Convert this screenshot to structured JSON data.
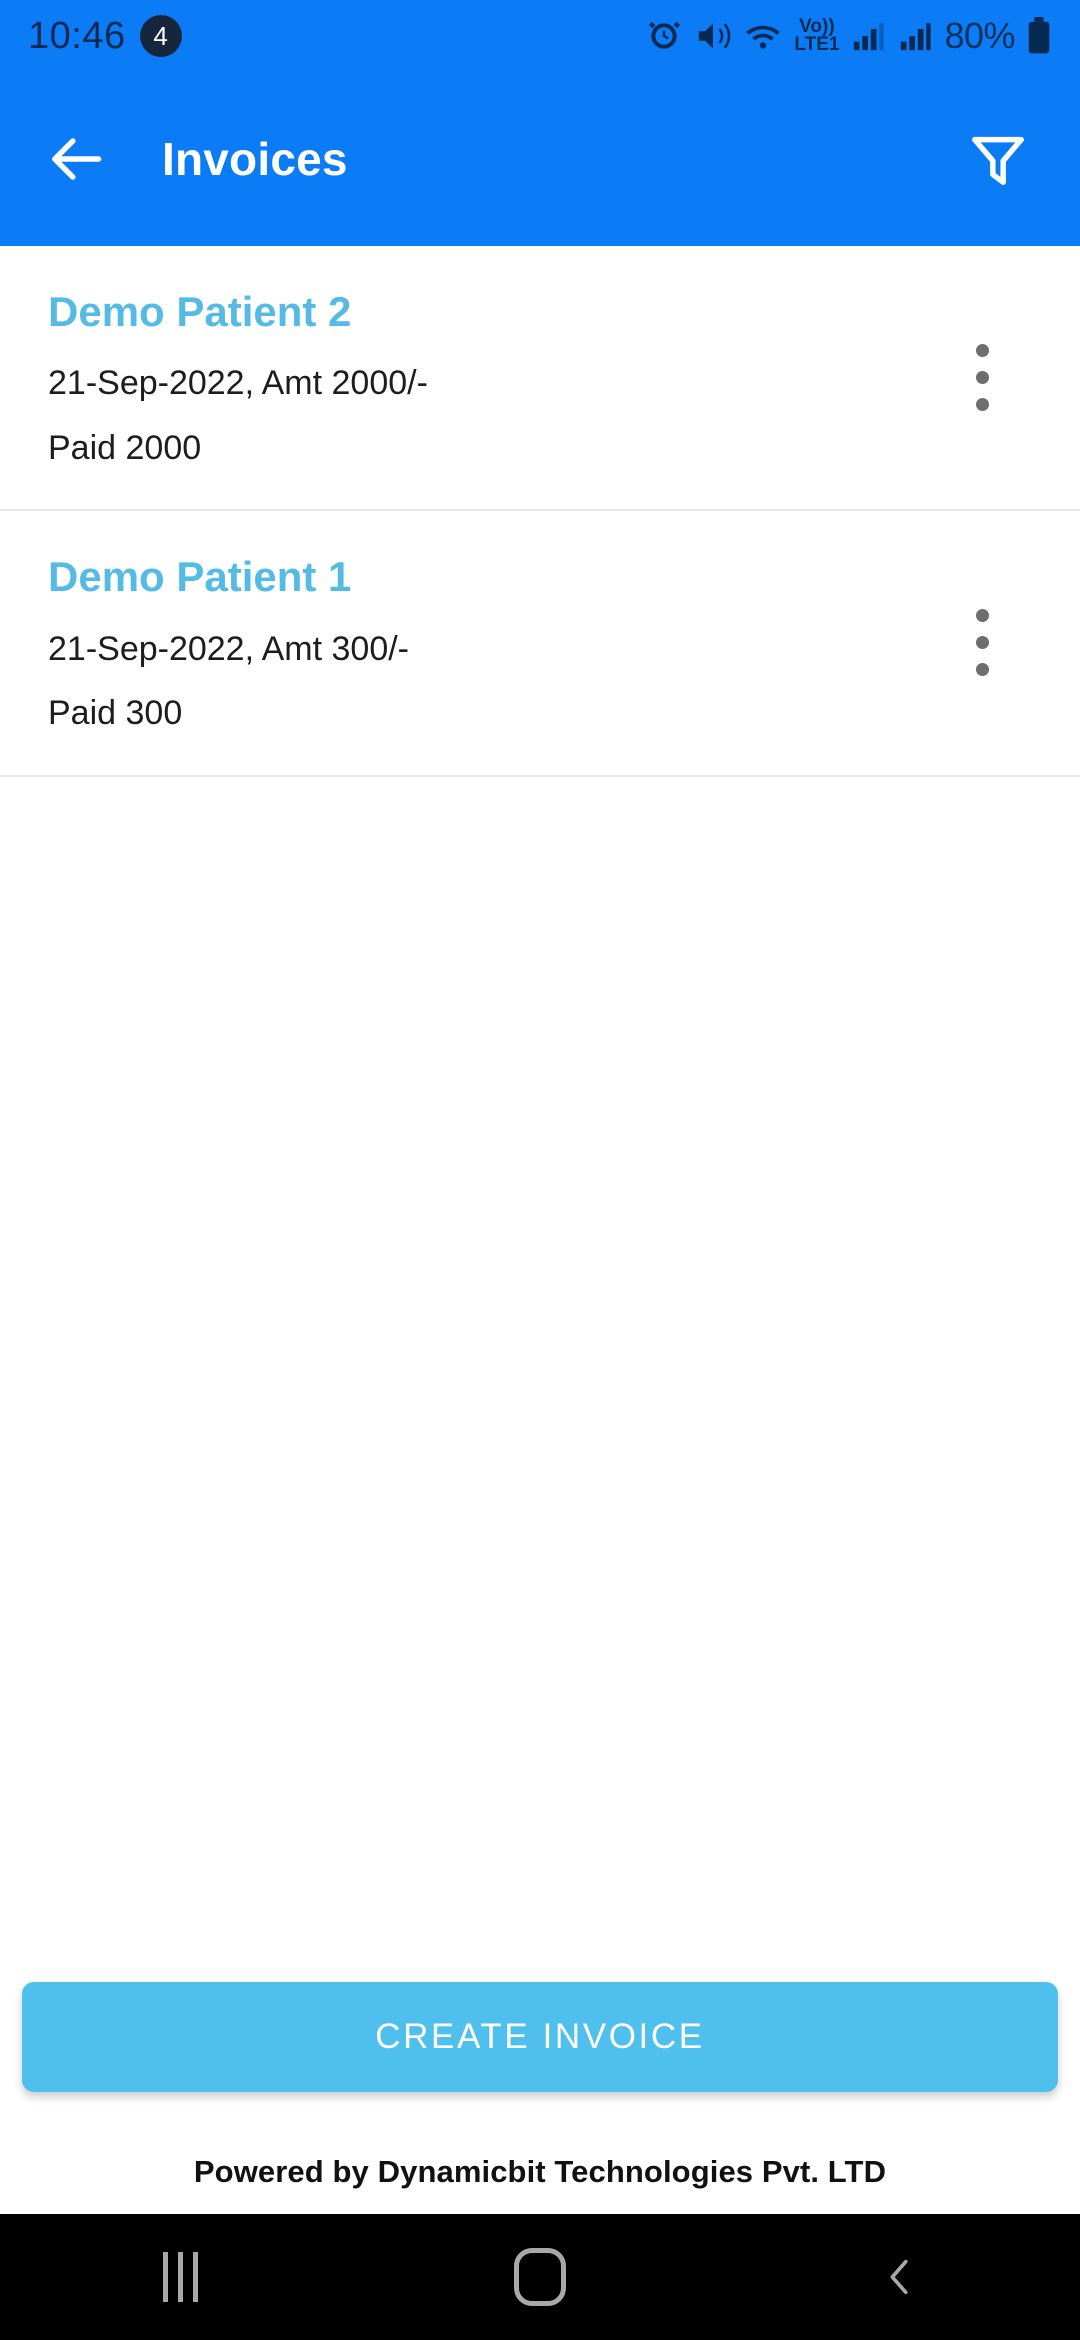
{
  "status_bar": {
    "time": "10:46",
    "notification_count": "4",
    "battery_percent": "80%",
    "icons": [
      "alarm-icon",
      "mute-vibrate-icon",
      "wifi-icon",
      "volte-lte1-icon",
      "signal-bars-1-icon",
      "signal-bars-2-icon",
      "battery-icon"
    ],
    "network_label": "Vo))",
    "network_sub_label": "LTE1"
  },
  "app_bar": {
    "title": "Invoices",
    "back_icon": "back-arrow-icon",
    "filter_icon": "filter-funnel-icon",
    "background_color": "#0B7CF5"
  },
  "invoices": [
    {
      "name": "Demo Patient 2",
      "meta": "21-Sep-2022, Amt 2000/-",
      "paid": "Paid 2000",
      "menu_icon": "overflow-menu-icon"
    },
    {
      "name": "Demo Patient 1",
      "meta": "21-Sep-2022, Amt 300/-",
      "paid": "Paid 300",
      "menu_icon": "overflow-menu-icon"
    }
  ],
  "bottom": {
    "create_button_label": "CREATE INVOICE",
    "create_button_color": "#4FC0EE",
    "footer_text": "Powered by Dynamicbit Technologies Pvt. LTD"
  },
  "nav_bar": {
    "recents_icon": "recents-icon",
    "home_icon": "home-icon",
    "back_icon": "nav-back-icon"
  },
  "colors": {
    "primary": "#0B7CF5",
    "accent": "#4FC0EE",
    "name_text": "#56bbe4"
  }
}
